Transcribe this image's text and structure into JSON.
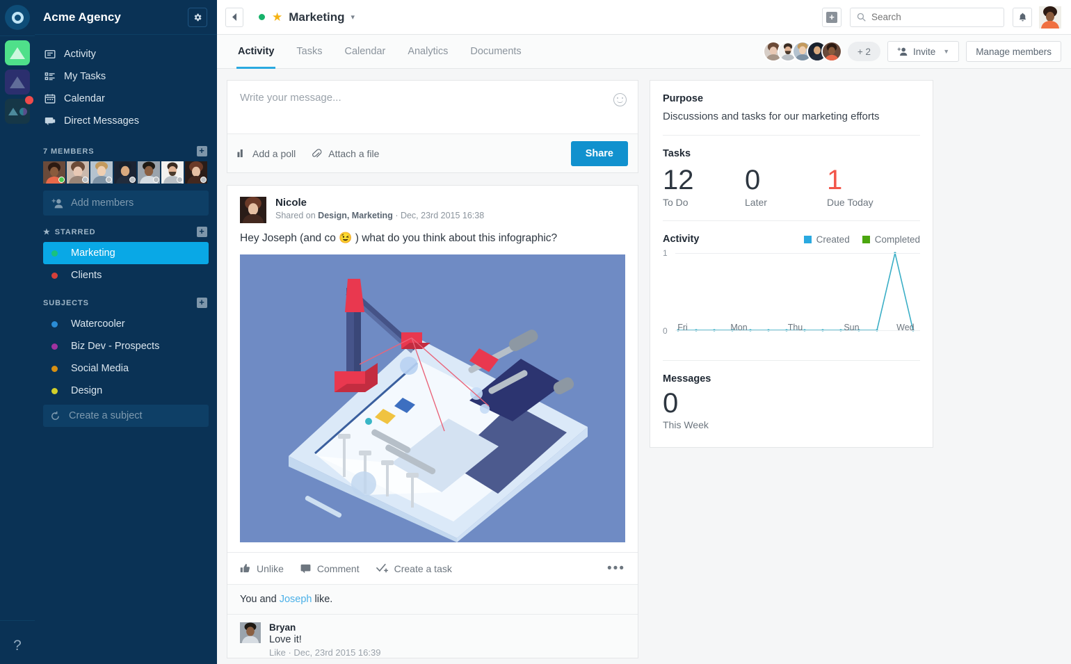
{
  "rail": {
    "logo_icon": "circle-logo-icon",
    "items": [
      {
        "name": "workspace-acme",
        "icon": "triangle-icon",
        "badge": false
      },
      {
        "name": "workspace-indigo",
        "icon": "triangle-icon",
        "badge": false
      },
      {
        "name": "workspace-teal",
        "icon": "triangle-circle-icon",
        "badge": true
      }
    ],
    "help_label": "?"
  },
  "sidebar": {
    "title": "Acme Agency",
    "settings_icon": "gear-icon",
    "nav": [
      {
        "label": "Activity",
        "icon": "activity-icon"
      },
      {
        "label": "My Tasks",
        "icon": "tasks-icon"
      },
      {
        "label": "Calendar",
        "icon": "calendar-icon"
      },
      {
        "label": "Direct Messages",
        "icon": "messages-icon"
      }
    ],
    "members_section": {
      "label": "7 MEMBERS",
      "add_icon": "plus-square-icon",
      "count": 7,
      "statuses": [
        "online",
        "away",
        "away",
        "away",
        "away",
        "away",
        "away"
      ],
      "add_members_placeholder": "Add members"
    },
    "starred_section": {
      "label": "STARRED",
      "star_icon": "star-icon",
      "add_icon": "plus-square-icon",
      "items": [
        {
          "label": "Marketing",
          "color": "#19c27e",
          "active": true
        },
        {
          "label": "Clients",
          "color": "#d5403a",
          "active": false
        }
      ]
    },
    "subjects_section": {
      "label": "SUBJECTS",
      "add_icon": "plus-square-icon",
      "items": [
        {
          "label": "Watercooler",
          "color": "#2a8cd6"
        },
        {
          "label": "Biz Dev - Prospects",
          "color": "#a033a0"
        },
        {
          "label": "Social Media",
          "color": "#d79013"
        },
        {
          "label": "Design",
          "color": "#d2cf2a"
        }
      ],
      "create_label": "Create a subject",
      "create_icon": "refresh-icon"
    }
  },
  "topbar": {
    "back_icon": "chevron-left-icon",
    "status_dot_color": "#17b26a",
    "star_icon": "star-icon",
    "title": "Marketing",
    "caret_icon": "chevron-down-icon",
    "add_icon": "plus-icon",
    "search": {
      "icon": "search-icon",
      "placeholder": "Search",
      "value": ""
    },
    "bell_icon": "bell-icon",
    "avatar": "user-avatar"
  },
  "tabs": [
    {
      "label": "Activity",
      "active": true
    },
    {
      "label": "Tasks",
      "active": false
    },
    {
      "label": "Calendar",
      "active": false
    },
    {
      "label": "Analytics",
      "active": false
    },
    {
      "label": "Documents",
      "active": false
    }
  ],
  "tab_right": {
    "avatar_count": 5,
    "overflow_label": "+ 2",
    "invite_label": "Invite",
    "invite_icon": "add-person-icon",
    "invite_caret": "chevron-down-icon",
    "manage_label": "Manage members"
  },
  "composer": {
    "placeholder": "Write your message...",
    "emoji_icon": "smiley-icon",
    "poll_label": "Add a poll",
    "poll_icon": "bar-chart-icon",
    "attach_label": "Attach a file",
    "attach_icon": "paperclip-icon",
    "share_label": "Share",
    "share_color": "#1191ce"
  },
  "post": {
    "author": "Nicole",
    "shared_prefix": "Shared on ",
    "channels": "Design, Marketing",
    "separator": " · ",
    "timestamp": "Dec, 23rd 2015 16:38",
    "text": "Hey Joseph (and co 😉 ) what do you think about this infographic?",
    "image_alt": "isometric-illustration-crane-building-smartphone",
    "image_bg": "#6f8bc4",
    "actions": [
      {
        "label": "Unlike",
        "icon": "thumbs-up-icon"
      },
      {
        "label": "Comment",
        "icon": "comment-icon"
      },
      {
        "label": "Create a task",
        "icon": "check-plus-icon"
      }
    ],
    "more_icon": "ellipsis-icon",
    "likes": {
      "prefix": "You  and  ",
      "link": "Joseph",
      "suffix": "  like."
    },
    "comment": {
      "author": "Bryan",
      "text": "Love it!",
      "meta_like": "Like",
      "meta_sep": " · ",
      "meta_time": "Dec, 23rd 2015 16:39"
    }
  },
  "aside": {
    "purpose_heading": "Purpose",
    "purpose_text": "Discussions and tasks for our marketing efforts",
    "tasks_heading": "Tasks",
    "tasks": [
      {
        "value": "12",
        "label": "To Do",
        "red": false
      },
      {
        "value": "0",
        "label": "Later",
        "red": false
      },
      {
        "value": "1",
        "label": "Due Today",
        "red": true
      }
    ],
    "activity_heading": "Activity",
    "messages_heading": "Messages",
    "messages_value": "0",
    "messages_label": "This Week"
  },
  "chart_data": {
    "type": "line",
    "title": "Activity",
    "xlabel": "",
    "ylabel": "",
    "ylim": [
      0,
      1
    ],
    "yticks": [
      "0",
      "1"
    ],
    "grid": true,
    "legend_position": "top-right",
    "x": [
      "Fri",
      "Sat",
      "Sun",
      "Mon",
      "Tue",
      "Wed",
      "Thu",
      "Fri",
      "Sat",
      "Sun",
      "Mon",
      "Tue",
      "Wed",
      "Thu"
    ],
    "tick_labels": [
      "Fri",
      "",
      "",
      "Mon",
      "",
      "",
      "Thu",
      "",
      "",
      "Sun",
      "",
      "",
      "Wed",
      ""
    ],
    "series": [
      {
        "name": "Created",
        "color": "#2aa9e0",
        "values": [
          0,
          0,
          0,
          0,
          0,
          0,
          0,
          0,
          0,
          0,
          0,
          0,
          1,
          0
        ]
      },
      {
        "name": "Completed",
        "color": "#4ba60e",
        "values": [
          0,
          0,
          0,
          0,
          0,
          0,
          0,
          0,
          0,
          0,
          0,
          0,
          0,
          0
        ]
      }
    ]
  }
}
